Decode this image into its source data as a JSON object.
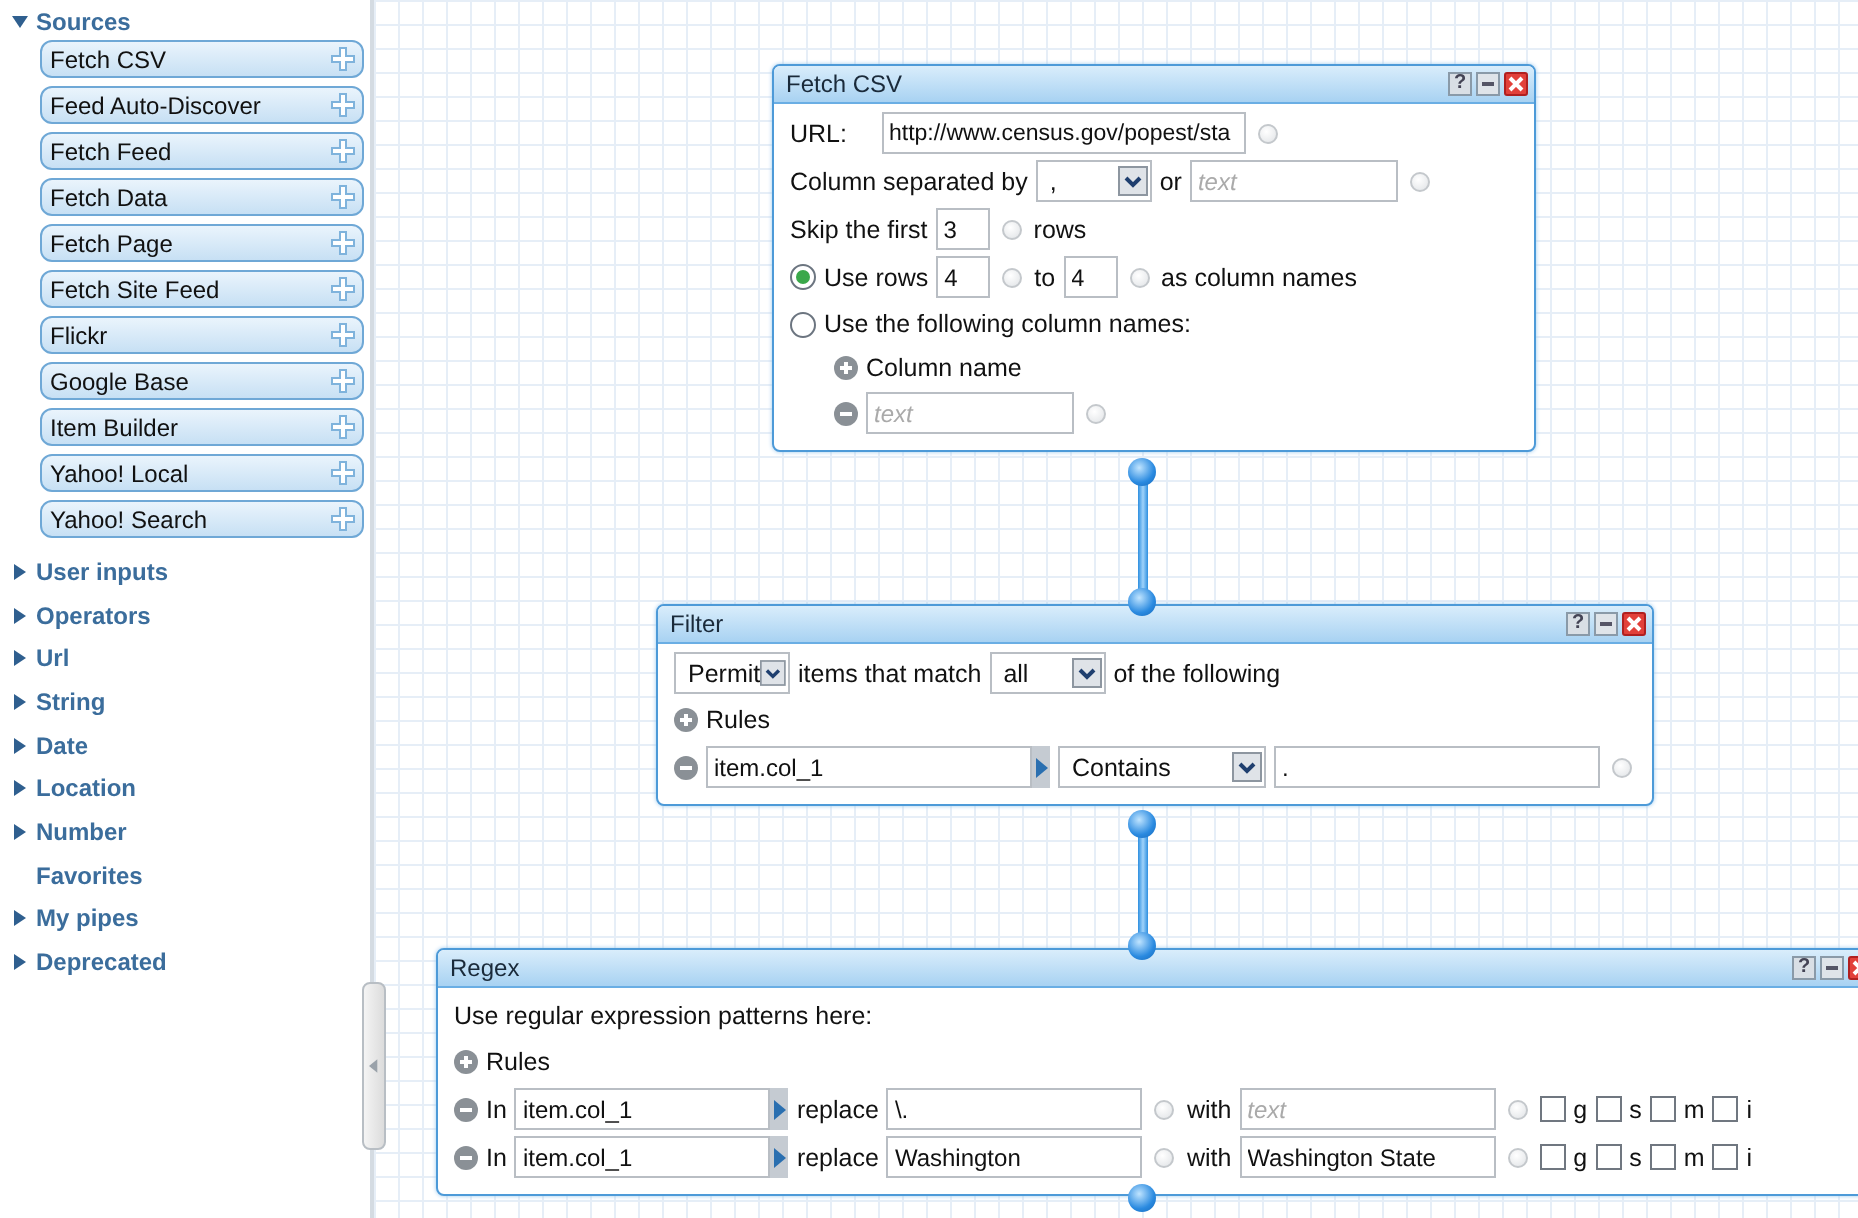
{
  "sidebar": {
    "categories": [
      {
        "label": "Sources",
        "kind": "group",
        "expanded": true,
        "children": [
          "Fetch CSV",
          "Feed Auto-Discover",
          "Fetch Feed",
          "Fetch Data",
          "Fetch Page",
          "Fetch Site Feed",
          "Flickr",
          "Google Base",
          "Item Builder",
          "Yahoo! Local",
          "Yahoo! Search"
        ]
      },
      {
        "label": "User inputs",
        "kind": "group",
        "expanded": false
      },
      {
        "label": "Operators",
        "kind": "group",
        "expanded": false
      },
      {
        "label": "Url",
        "kind": "group",
        "expanded": false
      },
      {
        "label": "String",
        "kind": "group",
        "expanded": false
      },
      {
        "label": "Date",
        "kind": "group",
        "expanded": false
      },
      {
        "label": "Location",
        "kind": "group",
        "expanded": false
      },
      {
        "label": "Number",
        "kind": "group",
        "expanded": false
      },
      {
        "label": "Favorites",
        "kind": "plain"
      },
      {
        "label": "My pipes",
        "kind": "group",
        "expanded": false
      },
      {
        "label": "Deprecated",
        "kind": "group",
        "expanded": false
      }
    ]
  },
  "modules": [
    {
      "kind": "fetch",
      "title": "Fetch CSV",
      "help": "?",
      "rows": [
        {
          "kind": "main",
          "parts": [
            {
              "kind": "label",
              "text": "URL:"
            },
            {
              "kind": "long-input",
              "value": "http://www.census.gov/popest/sta"
            },
            {
              "kind": "port"
            }
          ]
        },
        {
          "kind": "main",
          "parts": [
            {
              "kind": "label",
              "text": "Column separated by"
            },
            {
              "kind": "select",
              "value": ","
            },
            {
              "kind": "label",
              "text": "or"
            },
            {
              "kind": "input",
              "placeholder": "text"
            },
            {
              "kind": "port"
            }
          ]
        },
        {
          "kind": "main",
          "parts": [
            {
              "kind": "label",
              "text": "Skip the first"
            },
            {
              "kind": "short-input",
              "value": "3"
            },
            {
              "kind": "port"
            },
            {
              "kind": "label",
              "text": "rows"
            }
          ]
        },
        {
          "kind": "main",
          "parts": [
            {
              "kind": "radio",
              "selected": true
            },
            {
              "kind": "label",
              "text": "Use rows"
            },
            {
              "kind": "short-input",
              "value": "4"
            },
            {
              "kind": "port"
            },
            {
              "kind": "label",
              "text": "to"
            },
            {
              "kind": "short-input",
              "value": "4"
            },
            {
              "kind": "port"
            },
            {
              "kind": "label",
              "text": "as column names"
            }
          ]
        },
        {
          "kind": "main",
          "parts": [
            {
              "kind": "radio",
              "selected": false
            },
            {
              "kind": "label",
              "text": "Use the following column names:"
            }
          ]
        },
        {
          "kind": "sub",
          "parts": [
            {
              "kind": "add"
            },
            {
              "kind": "label",
              "text": "Column name"
            }
          ]
        },
        {
          "kind": "sub",
          "parts": [
            {
              "kind": "remove"
            },
            {
              "kind": "input",
              "placeholder": "text"
            },
            {
              "kind": "port"
            }
          ]
        }
      ]
    },
    {
      "kind": "filter",
      "title": "Filter",
      "help": "?",
      "rows": [
        {
          "kind": "main",
          "parts": [
            {
              "kind": "select",
              "value": "Permit"
            },
            {
              "kind": "label",
              "text": "items that match"
            },
            {
              "kind": "select",
              "value": "all"
            },
            {
              "kind": "label",
              "text": "of the following"
            }
          ]
        },
        {
          "kind": "main",
          "parts": [
            {
              "kind": "add"
            },
            {
              "kind": "label",
              "text": "Rules"
            }
          ]
        },
        {
          "kind": "main",
          "parts": [
            {
              "kind": "remove"
            },
            {
              "kind": "wide-input",
              "value": "item.col_1"
            },
            {
              "kind": "arrow"
            },
            {
              "kind": "long-select",
              "value": "Contains"
            },
            {
              "kind": "wide-input",
              "value": "."
            },
            {
              "kind": "port"
            }
          ]
        }
      ]
    },
    {
      "kind": "regex",
      "title": "Regex",
      "help": "?",
      "rows": [
        {
          "kind": "main",
          "parts": [
            {
              "kind": "label",
              "text": "Use regular expression patterns here:"
            }
          ]
        },
        {
          "kind": "main",
          "parts": [
            {
              "kind": "add"
            },
            {
              "kind": "label",
              "text": "Rules"
            }
          ]
        },
        {
          "kind": "main",
          "parts": [
            {
              "kind": "remove"
            },
            {
              "kind": "label",
              "text": "In"
            },
            {
              "kind": "input",
              "value": "item.col_1"
            },
            {
              "kind": "arrow"
            },
            {
              "kind": "label",
              "text": "replace"
            },
            {
              "kind": "input",
              "value": "\\."
            },
            {
              "kind": "port"
            },
            {
              "kind": "label",
              "text": "with"
            },
            {
              "kind": "input",
              "placeholder": "text"
            },
            {
              "kind": "port"
            },
            {
              "kind": "checkbox",
              "checked": false
            },
            {
              "kind": "label",
              "text": "g"
            },
            {
              "kind": "checkbox",
              "checked": false
            },
            {
              "kind": "label",
              "text": "s"
            },
            {
              "kind": "checkbox",
              "checked": false
            },
            {
              "kind": "label",
              "text": "m"
            },
            {
              "kind": "checkbox",
              "checked": false
            },
            {
              "kind": "label",
              "text": "i"
            }
          ]
        },
        {
          "kind": "main",
          "parts": [
            {
              "kind": "remove"
            },
            {
              "kind": "label",
              "text": "In"
            },
            {
              "kind": "input",
              "value": "item.col_1"
            },
            {
              "kind": "arrow"
            },
            {
              "kind": "label",
              "text": "replace"
            },
            {
              "kind": "input",
              "value": "Washington"
            },
            {
              "kind": "port"
            },
            {
              "kind": "label",
              "text": "with"
            },
            {
              "kind": "input",
              "value": "Washington State"
            },
            {
              "kind": "port"
            },
            {
              "kind": "checkbox",
              "checked": false
            },
            {
              "kind": "label",
              "text": "g"
            },
            {
              "kind": "checkbox",
              "checked": false
            },
            {
              "kind": "label",
              "text": "s"
            },
            {
              "kind": "checkbox",
              "checked": false
            },
            {
              "kind": "label",
              "text": "m"
            },
            {
              "kind": "checkbox",
              "checked": false
            },
            {
              "kind": "label",
              "text": "i"
            }
          ]
        }
      ]
    }
  ]
}
